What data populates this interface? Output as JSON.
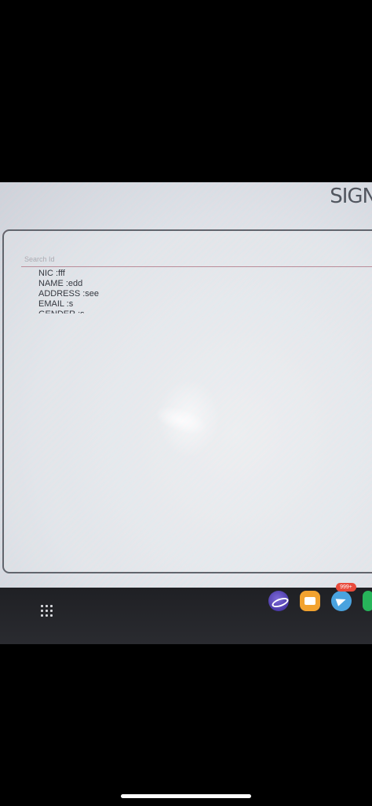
{
  "header": {
    "sign_label": "SIGN"
  },
  "search": {
    "placeholder": "Search Id"
  },
  "record": {
    "nic": "NIC :fff",
    "name": "NAME :edd",
    "address": "ADDRESS :see",
    "email": "EMAIL :s",
    "gender": "GENDER :s"
  },
  "taskbar": {
    "apps_button": "apps-grid-icon",
    "apps": [
      {
        "name": "samsung-internet-icon",
        "color": "#5a48b8"
      },
      {
        "name": "my-files-icon",
        "color": "#f2a22e"
      },
      {
        "name": "telegram-icon",
        "color": "#4aa3df",
        "badge": "999+"
      },
      {
        "name": "green-app-icon",
        "color": "#27b45a"
      }
    ]
  }
}
